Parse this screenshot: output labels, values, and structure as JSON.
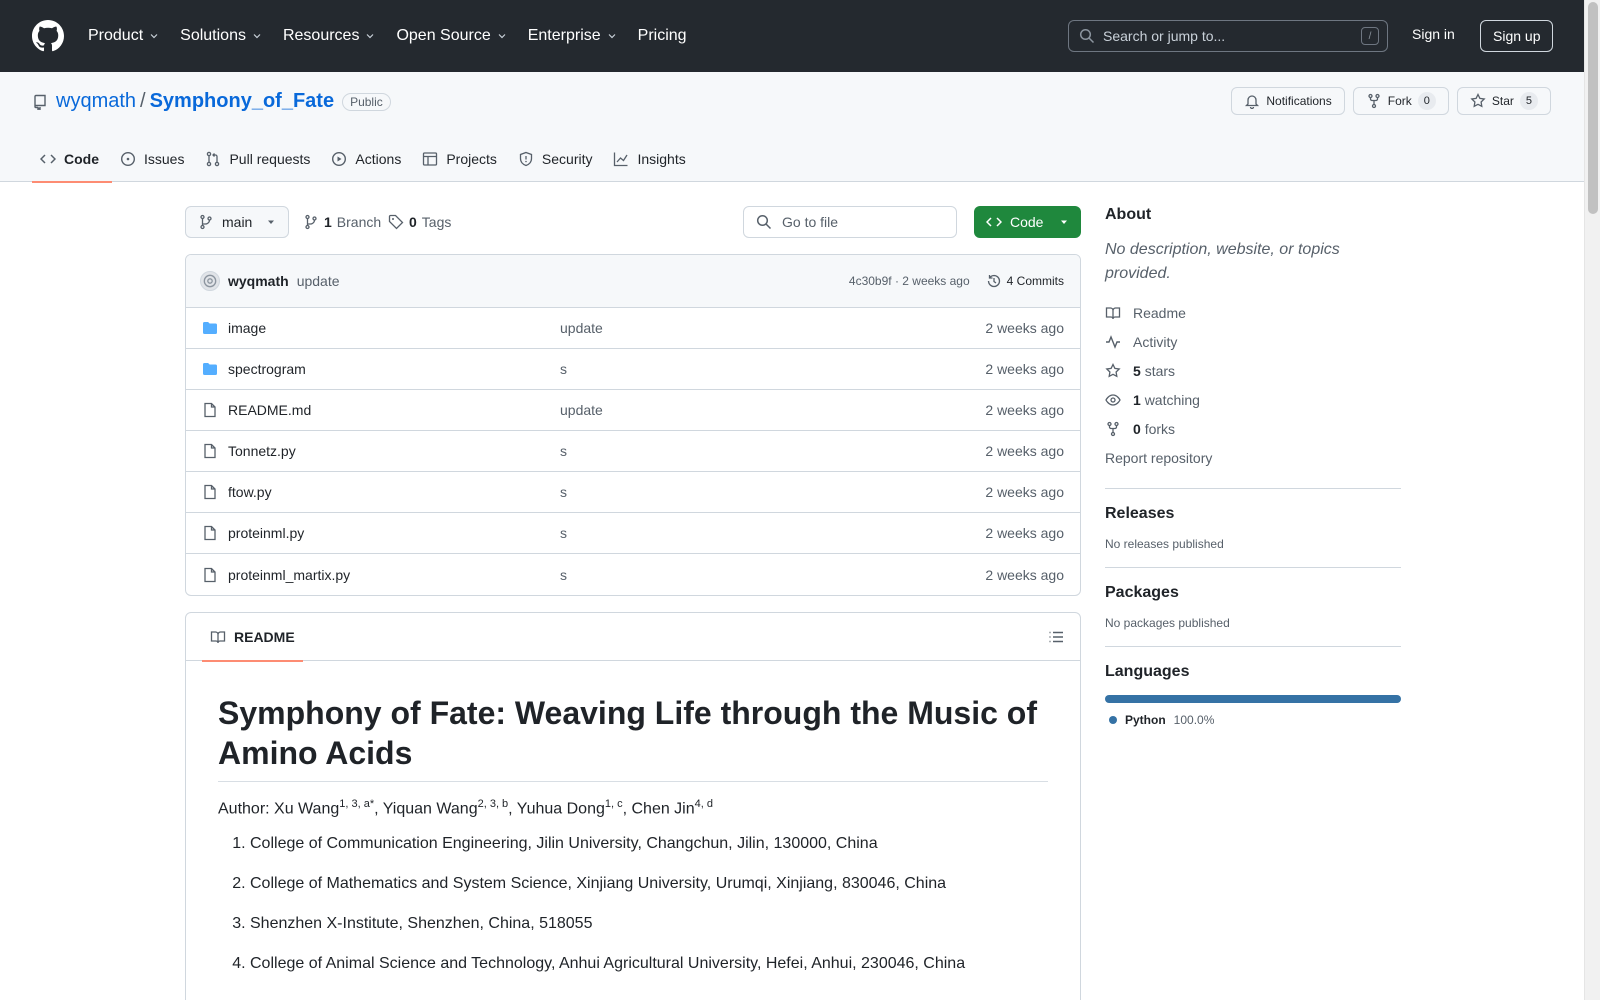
{
  "header": {
    "nav": [
      "Product",
      "Solutions",
      "Resources",
      "Open Source",
      "Enterprise",
      "Pricing"
    ],
    "search_placeholder": "Search or jump to...",
    "search_key": "/",
    "signin": "Sign in",
    "signup": "Sign up"
  },
  "repo": {
    "owner": "wyqmath",
    "separator": "/",
    "name": "Symphony_of_Fate",
    "visibility": "Public",
    "notifications": "Notifications",
    "fork_label": "Fork",
    "fork_count": "0",
    "star_label": "Star",
    "star_count": "5"
  },
  "tabs": [
    "Code",
    "Issues",
    "Pull requests",
    "Actions",
    "Projects",
    "Security",
    "Insights"
  ],
  "toolbar": {
    "branch": "main",
    "branch_count": "1",
    "branch_label": "Branch",
    "tag_count": "0",
    "tag_label": "Tags",
    "goto_placeholder": "Go to file",
    "code_button": "Code"
  },
  "commit": {
    "author": "wyqmath",
    "message": "update",
    "hash_time": "4c30b9f · 2 weeks ago",
    "commits": "4 Commits"
  },
  "files": [
    {
      "name": "image",
      "type": "folder",
      "message": "update",
      "date": "2 weeks ago"
    },
    {
      "name": "spectrogram",
      "type": "folder",
      "message": "s",
      "date": "2 weeks ago"
    },
    {
      "name": "README.md",
      "type": "file",
      "message": "update",
      "date": "2 weeks ago"
    },
    {
      "name": "Tonnetz.py",
      "type": "file",
      "message": "s",
      "date": "2 weeks ago"
    },
    {
      "name": "ftow.py",
      "type": "file",
      "message": "s",
      "date": "2 weeks ago"
    },
    {
      "name": "proteinml.py",
      "type": "file",
      "message": "s",
      "date": "2 weeks ago"
    },
    {
      "name": "proteinml_martix.py",
      "type": "file",
      "message": "s",
      "date": "2 weeks ago"
    }
  ],
  "readme": {
    "tab": "README",
    "title": "Symphony of Fate: Weaving Life through the Music of Amino Acids",
    "author_prefix": "Author: ",
    "authors": [
      {
        "name": "Xu Wang",
        "sup": "1, 3, a*"
      },
      {
        "name": "Yiquan Wang",
        "sup": "2, 3, b"
      },
      {
        "name": "Yuhua Dong",
        "sup": "1, c"
      },
      {
        "name": "Chen Jin",
        "sup": "4, d"
      }
    ],
    "affiliations": [
      "College of Communication Engineering, Jilin University, Changchun, Jilin, 130000, China",
      "College of Mathematics and System Science, Xinjiang University, Urumqi, Xinjiang, 830046, China",
      "Shenzhen X-Institute, Shenzhen, China, 518055",
      "College of Animal Science and Technology, Anhui Agricultural University, Hefei, Anhui, 230046, China"
    ]
  },
  "about": {
    "heading": "About",
    "description": "No description, website, or topics provided.",
    "readme": "Readme",
    "activity": "Activity",
    "stars_count": "5",
    "stars_label": "stars",
    "watching_count": "1",
    "watching_label": "watching",
    "forks_count": "0",
    "forks_label": "forks",
    "report": "Report repository"
  },
  "releases": {
    "heading": "Releases",
    "text": "No releases published"
  },
  "packages": {
    "heading": "Packages",
    "text": "No packages published"
  },
  "languages": {
    "heading": "Languages",
    "name": "Python",
    "percent": "100.0%",
    "color": "#3572a5"
  }
}
